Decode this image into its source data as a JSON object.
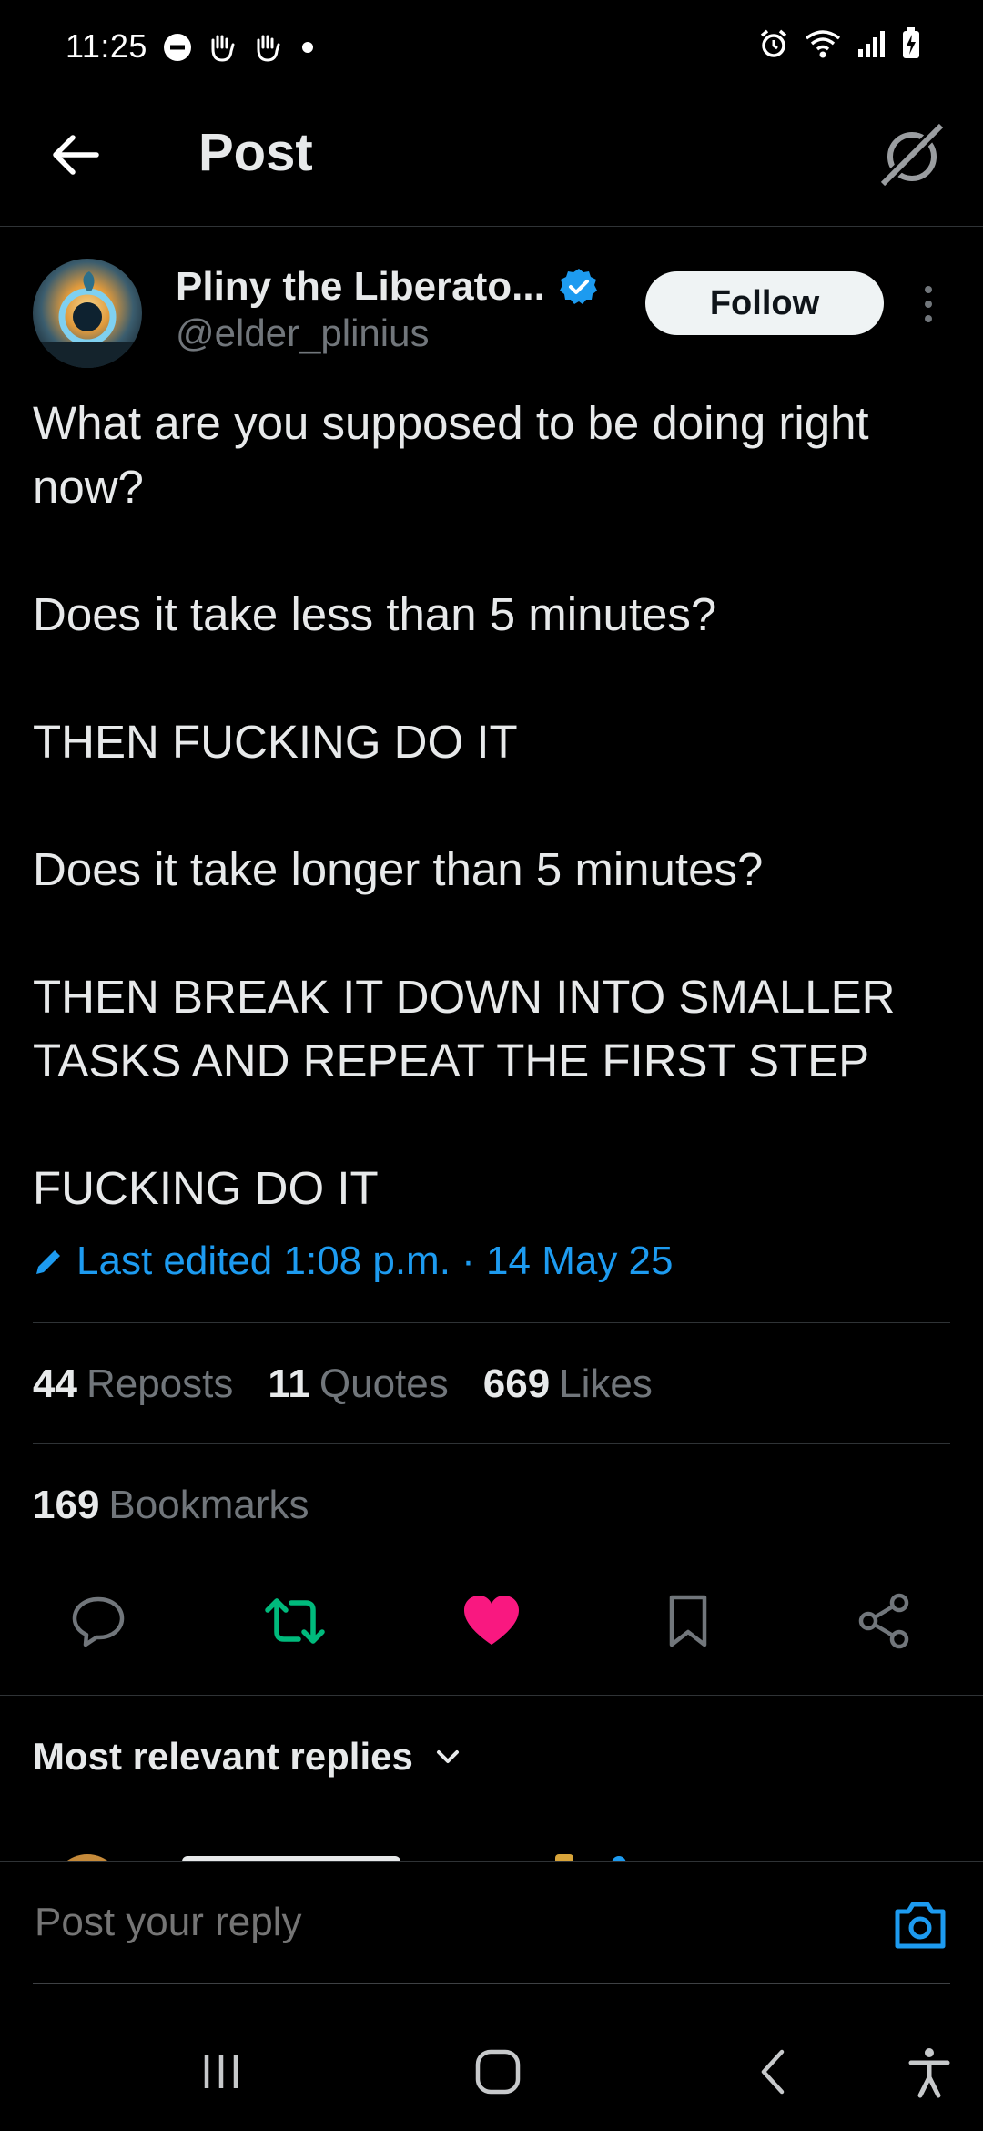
{
  "status_bar": {
    "time": "11:25"
  },
  "header": {
    "title": "Post"
  },
  "author": {
    "name": "Pliny the Liberato...",
    "handle": "@elder_plinius",
    "follow_label": "Follow"
  },
  "tweet": {
    "paragraphs": [
      "What are you supposed to be doing right now?",
      "Does it take less than 5 minutes?",
      "THEN FUCKING DO IT",
      "Does it take longer than 5 minutes?",
      "THEN BREAK IT DOWN INTO SMALLER TASKS AND REPEAT THE FIRST STEP",
      "FUCKING DO IT"
    ],
    "edited_label": "Last edited 1:08 p.m. · 14 May 25"
  },
  "stats": {
    "reposts_count": "44",
    "reposts_label": "Reposts",
    "quotes_count": "11",
    "quotes_label": "Quotes",
    "likes_count": "669",
    "likes_label": "Likes",
    "bookmarks_count": "169",
    "bookmarks_label": "Bookmarks"
  },
  "actions": {
    "like_color": "#f91880",
    "repost_color": "#00ba7c",
    "icons": [
      "reply-icon",
      "repost-icon",
      "like-icon",
      "bookmark-icon",
      "share-icon"
    ]
  },
  "replies": {
    "sort_label": "Most relevant replies"
  },
  "reply_bar": {
    "placeholder": "Post your reply"
  },
  "colors": {
    "background": "#000000",
    "text": "#e7e9ea",
    "muted": "#71767b",
    "accent": "#1d9bf0",
    "divider": "#2f3336"
  }
}
